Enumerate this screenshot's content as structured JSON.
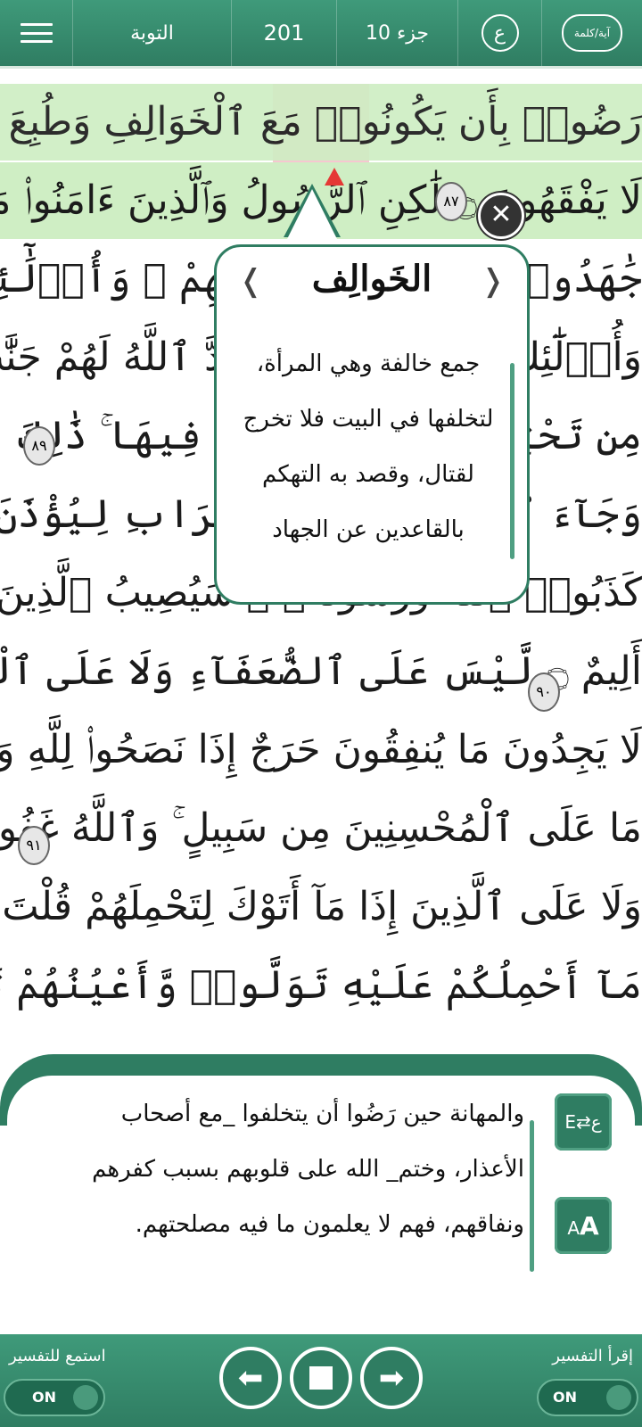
{
  "topbar": {
    "surah_name": "التوبة",
    "page_number": "201",
    "juz": "جزء 10",
    "ain_symbol": "ع",
    "mode_label": "آية/كلمة"
  },
  "quran": {
    "lines": [
      "رَضُوا۟ بِأَن يَكُونُوا۟ مَعَ ٱلْخَوَالِفِ وَطُبِعَ عَلَىٰ قُلُوبِهِمْ فَهُمْ",
      "لَا يَفْقَهُونَ ۝ لَٰكِنِ ٱلرَّسُولُ وَٱلَّذِينَ ءَامَنُوا۟ مَعَهُۥ",
      "جَٰهَدُوا۟ بِأَمْوَٰلِهِمْ وَأَنفُسِهِمْ ۚ وَأُو۟لَٰٓئِكَ لَهُمُ ٱلْخَيْرَٰتُ",
      "وَأُو۟لَٰٓئِكَ هُمُ ٱلْمُفْلِحُونَ أَعَدَّ ٱللَّهُ لَهُمْ جَنَّٰتٍ تَجْرِى",
      "مِن تَحْتِهَا ٱلْأَنْهَٰرُ خَٰلِدِينَ فِيهَا ۚ ذَٰلِكَ ٱلْفَوْزُ ٱلْعَظِيمُ",
      "وَجَآءَ ٱلْمُعَذِّرُونَ مِنَ ٱلْأَعْرَابِ لِيُؤْذَنَ لَهُمْ وَقَعَدَ ٱلَّذِينَ",
      "كَذَبُوا۟ ٱللَّهَ وَرَسُولَهُۥ ۚ سَيُصِيبُ ٱلَّذِينَ كَفَرُوا۟ مِنْهُمْ عَذَابٌ",
      "أَلِيمٌ ۝ لَّيْسَ عَلَى ٱلضُّعَفَآءِ وَلَا عَلَى ٱلْمَرْضَىٰ وَلَا عَلَى ٱلَّذِينَ",
      "لَا يَجِدُونَ مَا يُنفِقُونَ حَرَجٌ إِذَا نَصَحُوا۟ لِلَّهِ وَرَسُولِهِۦ",
      "مَا عَلَى ٱلْمُحْسِنِينَ مِن سَبِيلٍ ۚ وَٱللَّهُ غَفُورٌ رَّحِيمٌ ۝",
      "وَلَا عَلَى ٱلَّذِينَ إِذَا مَآ أَتَوْكَ لِتَحْمِلَهُمْ قُلْتَ لَآ أَجِدُ",
      "مَآ أَحْمِلُكُمْ عَلَيْهِ تَوَلَّوا۟ وَّأَعْيُنُهُمْ تَفِيضُ مِنَ ٱلدَّمْعِ"
    ],
    "ayah_numbers": [
      "٨٧",
      "٨٩",
      "٩٠",
      "٩١"
    ]
  },
  "popup": {
    "title": "الخَوالِف",
    "body": "جمع خالفة وهي المرأة، لتخلفها في البيت فلا تخرج لقتال، وقصد به التهكم بالقاعدين عن الجهاد"
  },
  "tafsir": {
    "text": "والمهانة حين رَضُوا أن يتخلفوا _مع أصحاب الأعذار، وختم_ الله على قلوبهم بسبب كفرهم ونفاقهم، فهم لا يعلمون ما فيه مصلحتهم."
  },
  "bottombar": {
    "listen_label": "استمع للتفسير",
    "read_label": "إقرأ التفسير",
    "toggle_left": "ON",
    "toggle_right": "ON",
    "listen_on": true,
    "read_on": true
  },
  "colors": {
    "primary_green": "#2f7d62",
    "highlight_green": "#cfeec4",
    "highlight_pink": "#f6c7d0",
    "marker_red": "#e53935"
  }
}
